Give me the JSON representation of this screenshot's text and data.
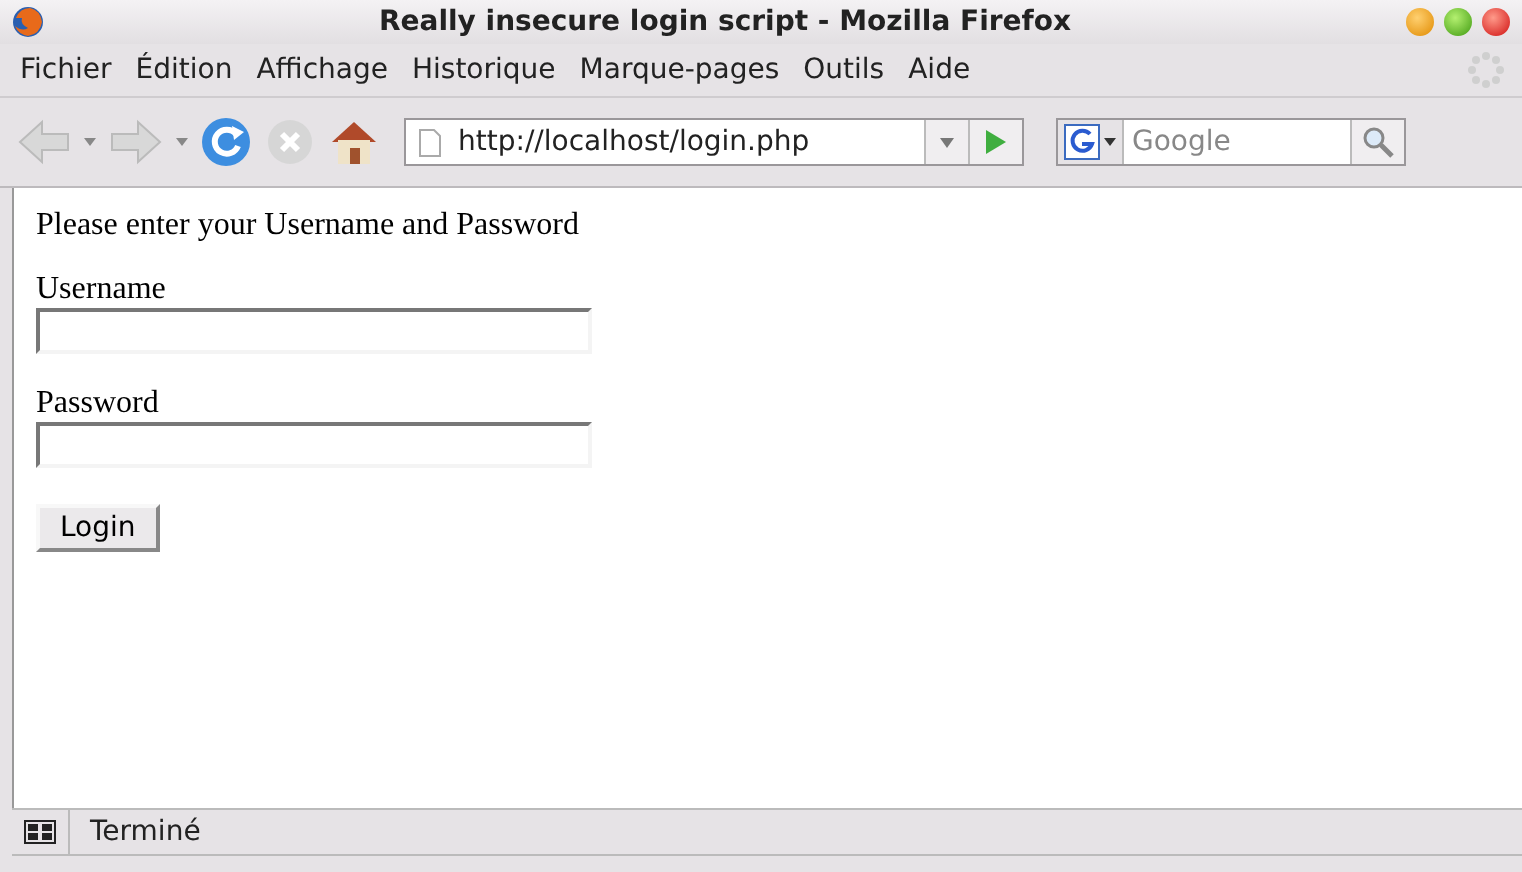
{
  "window": {
    "title": "Really insecure login script - Mozilla Firefox"
  },
  "menu": [
    {
      "label": "Fichier"
    },
    {
      "label": "Édition"
    },
    {
      "label": "Affichage"
    },
    {
      "label": "Historique"
    },
    {
      "label": "Marque-pages"
    },
    {
      "label": "Outils"
    },
    {
      "label": "Aide"
    }
  ],
  "toolbar": {
    "back_disabled": true,
    "forward_disabled": true,
    "url": "http://localhost/login.php",
    "search": {
      "placeholder": "Google"
    }
  },
  "page": {
    "intro": "Please enter your Username and Password",
    "fields": [
      {
        "label": "Username"
      },
      {
        "label": "Password"
      }
    ],
    "button": "Login"
  },
  "status_bar": {
    "text": "Terminé"
  }
}
